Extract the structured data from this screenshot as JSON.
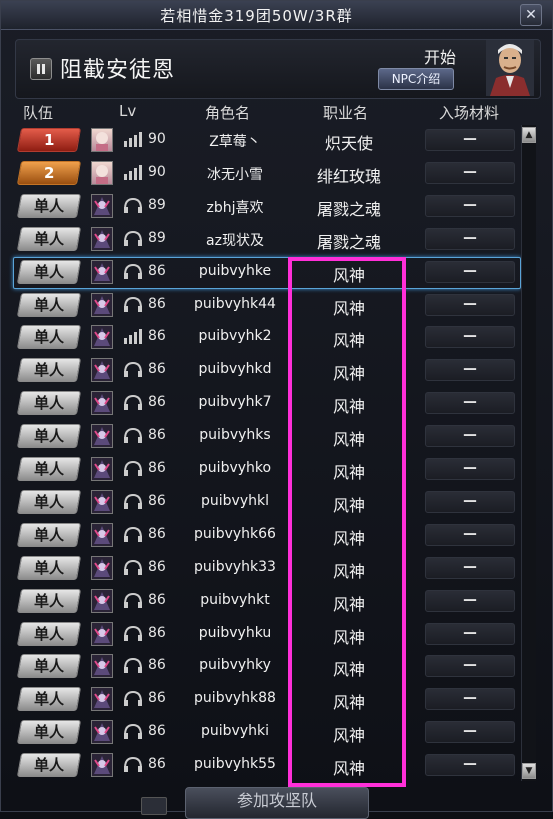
{
  "window": {
    "title": "若相惜金319团50W/3R群",
    "close_icon": "close-icon"
  },
  "header": {
    "dungeon_name": "阻截安徒恩",
    "start_label": "开始",
    "npc_button_label": "NPC介绍",
    "npc_icon": "npc-portrait-icon"
  },
  "columns": {
    "team": "队伍",
    "lv": "Lv",
    "name": "角色名",
    "job": "职业名",
    "material": "入场材料"
  },
  "rows": [
    {
      "team": "1",
      "team_style": "red",
      "lv": "90",
      "name": "Z草莓丶",
      "job": "炽天使",
      "material": "－",
      "voice": "signal-icon"
    },
    {
      "team": "2",
      "team_style": "orange",
      "lv": "90",
      "name": "冰无小雪",
      "job": "绯红玫瑰",
      "material": "－",
      "voice": "signal-icon"
    },
    {
      "team": "单人",
      "team_style": "gray",
      "lv": "89",
      "name": "zbhj喜欢",
      "job": "屠戮之魂",
      "material": "－",
      "voice": "headset-icon"
    },
    {
      "team": "单人",
      "team_style": "gray",
      "lv": "89",
      "name": "az现状及",
      "job": "屠戮之魂",
      "material": "－",
      "voice": "headset-icon"
    },
    {
      "team": "单人",
      "team_style": "gray",
      "lv": "86",
      "name": "puibvyhke",
      "job": "风神",
      "material": "－",
      "voice": "headset-icon",
      "selected": true
    },
    {
      "team": "单人",
      "team_style": "gray",
      "lv": "86",
      "name": "puibvyhk44",
      "job": "风神",
      "material": "－",
      "voice": "headset-icon"
    },
    {
      "team": "单人",
      "team_style": "gray",
      "lv": "86",
      "name": "puibvyhk2",
      "job": "风神",
      "material": "－",
      "voice": "signal-icon"
    },
    {
      "team": "单人",
      "team_style": "gray",
      "lv": "86",
      "name": "puibvyhkd",
      "job": "风神",
      "material": "－",
      "voice": "headset-icon"
    },
    {
      "team": "单人",
      "team_style": "gray",
      "lv": "86",
      "name": "puibvyhk7",
      "job": "风神",
      "material": "－",
      "voice": "headset-icon"
    },
    {
      "team": "单人",
      "team_style": "gray",
      "lv": "86",
      "name": "puibvyhks",
      "job": "风神",
      "material": "－",
      "voice": "headset-icon"
    },
    {
      "team": "单人",
      "team_style": "gray",
      "lv": "86",
      "name": "puibvyhko",
      "job": "风神",
      "material": "－",
      "voice": "headset-icon"
    },
    {
      "team": "单人",
      "team_style": "gray",
      "lv": "86",
      "name": "puibvyhkl",
      "job": "风神",
      "material": "－",
      "voice": "headset-icon"
    },
    {
      "team": "单人",
      "team_style": "gray",
      "lv": "86",
      "name": "puibvyhk66",
      "job": "风神",
      "material": "－",
      "voice": "headset-icon"
    },
    {
      "team": "单人",
      "team_style": "gray",
      "lv": "86",
      "name": "puibvyhk33",
      "job": "风神",
      "material": "－",
      "voice": "headset-icon"
    },
    {
      "team": "单人",
      "team_style": "gray",
      "lv": "86",
      "name": "puibvyhkt",
      "job": "风神",
      "material": "－",
      "voice": "headset-icon"
    },
    {
      "team": "单人",
      "team_style": "gray",
      "lv": "86",
      "name": "puibvyhku",
      "job": "风神",
      "material": "－",
      "voice": "headset-icon"
    },
    {
      "team": "单人",
      "team_style": "gray",
      "lv": "86",
      "name": "puibvyhky",
      "job": "风神",
      "material": "－",
      "voice": "headset-icon"
    },
    {
      "team": "单人",
      "team_style": "gray",
      "lv": "86",
      "name": "puibvyhk88",
      "job": "风神",
      "material": "－",
      "voice": "headset-icon"
    },
    {
      "team": "单人",
      "team_style": "gray",
      "lv": "86",
      "name": "puibvyhki",
      "job": "风神",
      "material": "－",
      "voice": "headset-icon"
    },
    {
      "team": "单人",
      "team_style": "gray",
      "lv": "86",
      "name": "puibvyhk55",
      "job": "风神",
      "material": "－",
      "voice": "headset-icon"
    }
  ],
  "footer": {
    "join_button_label": "参加攻坚队"
  },
  "colors": {
    "highlight": "#ff2fd8",
    "selected_row": "#5aa4d8"
  }
}
